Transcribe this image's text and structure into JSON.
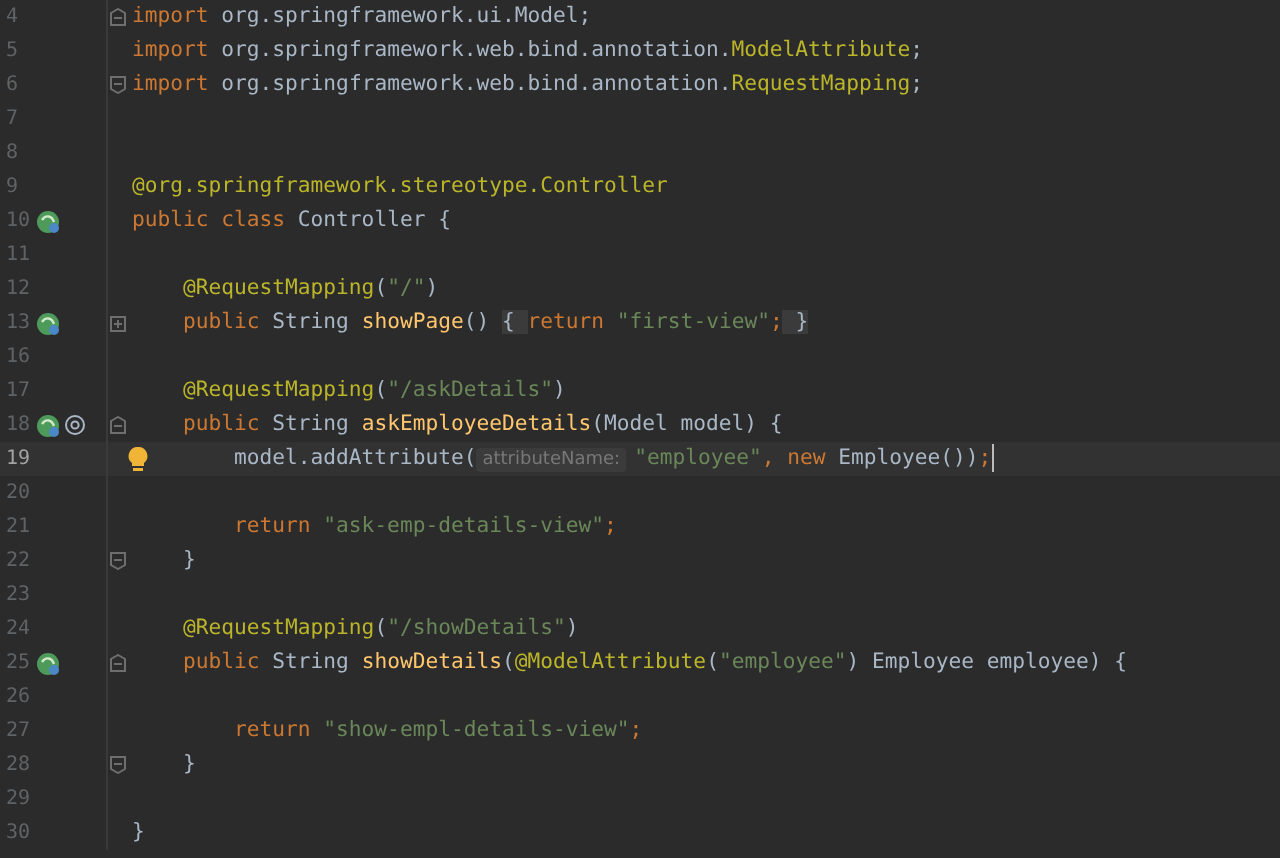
{
  "editor": {
    "lines": [
      {
        "number": "4",
        "fold": {
          "kind": "start"
        },
        "tokens": [
          {
            "kind": "kw",
            "text": "import"
          },
          {
            "kind": "pkg",
            "text": " org.springframework.ui.Model;"
          }
        ]
      },
      {
        "number": "5",
        "tokens": [
          {
            "kind": "kw",
            "text": "import"
          },
          {
            "kind": "pkg",
            "text": " org.springframework.web.bind.annotation."
          },
          {
            "kind": "ref",
            "text": "ModelAttribute"
          },
          {
            "kind": "pkg",
            "text": ";"
          }
        ]
      },
      {
        "number": "6",
        "fold": {
          "kind": "end"
        },
        "tokens": [
          {
            "kind": "kw",
            "text": "import"
          },
          {
            "kind": "pkg",
            "text": " org.springframework.web.bind.annotation."
          },
          {
            "kind": "ref",
            "text": "RequestMapping"
          },
          {
            "kind": "pkg",
            "text": ";"
          }
        ]
      },
      {
        "number": "7"
      },
      {
        "number": "8"
      },
      {
        "number": "9",
        "tokens": [
          {
            "kind": "ann",
            "text": "@org.springframework.stereotype."
          },
          {
            "kind": "ref",
            "text": "Controller"
          }
        ]
      },
      {
        "number": "10",
        "gutter": [
          {
            "kind": "bean"
          }
        ],
        "tokens": [
          {
            "kind": "kw",
            "text": "public class "
          },
          {
            "kind": "plain",
            "text": "Controller {"
          }
        ]
      },
      {
        "number": "11"
      },
      {
        "number": "12",
        "tokens": [
          {
            "kind": "ann",
            "text": "    @RequestMapping"
          },
          {
            "kind": "plain",
            "text": "("
          },
          {
            "kind": "str",
            "text": "\"/\""
          },
          {
            "kind": "plain",
            "text": ")"
          }
        ]
      },
      {
        "number": "13",
        "fold": {
          "kind": "collapsed"
        },
        "gutter": [
          {
            "kind": "bean"
          }
        ],
        "tokens": [
          {
            "kind": "kw",
            "text": "    public "
          },
          {
            "kind": "plain",
            "text": "String "
          },
          {
            "kind": "method",
            "text": "showPage"
          },
          {
            "kind": "plain",
            "text": "() "
          },
          {
            "kind": "folded",
            "text": "{ "
          },
          {
            "kind": "kw",
            "text": "return "
          },
          {
            "kind": "str",
            "text": "\"first-view\""
          },
          {
            "kind": "kw",
            "text": ";"
          },
          {
            "kind": "folded",
            "text": " }"
          }
        ]
      },
      {
        "number": "16"
      },
      {
        "number": "17",
        "tokens": [
          {
            "kind": "ann",
            "text": "    @RequestMapping"
          },
          {
            "kind": "plain",
            "text": "("
          },
          {
            "kind": "str",
            "text": "\"/askDetails\""
          },
          {
            "kind": "plain",
            "text": ")"
          }
        ]
      },
      {
        "number": "18",
        "fold": {
          "kind": "start"
        },
        "gutter": [
          {
            "kind": "bean"
          },
          {
            "kind": "at"
          }
        ],
        "tokens": [
          {
            "kind": "kw",
            "text": "    public "
          },
          {
            "kind": "plain",
            "text": "String "
          },
          {
            "kind": "method",
            "text": "askEmployeeDetails"
          },
          {
            "kind": "plain",
            "text": "(Model model) {"
          }
        ]
      },
      {
        "number": "19",
        "current": true,
        "bulb": true,
        "caret": true,
        "tokens": [
          {
            "kind": "plain",
            "text": "        model.addAttribute("
          },
          {
            "kind": "hint",
            "text": "attributeName:"
          },
          {
            "kind": "str",
            "text": "\"employee\""
          },
          {
            "kind": "kw",
            "text": ", new "
          },
          {
            "kind": "plain",
            "text": "Employee())"
          },
          {
            "kind": "kw",
            "text": ";"
          }
        ]
      },
      {
        "number": "20"
      },
      {
        "number": "21",
        "tokens": [
          {
            "kind": "kw",
            "text": "        return "
          },
          {
            "kind": "str",
            "text": "\"ask-emp-details-view\""
          },
          {
            "kind": "kw",
            "text": ";"
          }
        ]
      },
      {
        "number": "22",
        "fold": {
          "kind": "end"
        },
        "tokens": [
          {
            "kind": "plain",
            "text": "    }"
          }
        ]
      },
      {
        "number": "23"
      },
      {
        "number": "24",
        "tokens": [
          {
            "kind": "ann",
            "text": "    @RequestMapping"
          },
          {
            "kind": "plain",
            "text": "("
          },
          {
            "kind": "str",
            "text": "\"/showDetails\""
          },
          {
            "kind": "plain",
            "text": ")"
          }
        ]
      },
      {
        "number": "25",
        "fold": {
          "kind": "start"
        },
        "gutter": [
          {
            "kind": "bean"
          }
        ],
        "tokens": [
          {
            "kind": "kw",
            "text": "    public "
          },
          {
            "kind": "plain",
            "text": "String "
          },
          {
            "kind": "method",
            "text": "showDetails"
          },
          {
            "kind": "plain",
            "text": "("
          },
          {
            "kind": "ann",
            "text": "@ModelAttribute"
          },
          {
            "kind": "plain",
            "text": "("
          },
          {
            "kind": "str",
            "text": "\"employee\""
          },
          {
            "kind": "plain",
            "text": ") Employee employee) {"
          }
        ]
      },
      {
        "number": "26"
      },
      {
        "number": "27",
        "tokens": [
          {
            "kind": "kw",
            "text": "        return "
          },
          {
            "kind": "str",
            "text": "\"show-empl-details-view\""
          },
          {
            "kind": "kw",
            "text": ";"
          }
        ]
      },
      {
        "number": "28",
        "fold": {
          "kind": "end"
        },
        "tokens": [
          {
            "kind": "plain",
            "text": "    }"
          }
        ]
      },
      {
        "number": "29"
      },
      {
        "number": "30",
        "tokens": [
          {
            "kind": "plain",
            "text": "}"
          }
        ]
      }
    ]
  }
}
